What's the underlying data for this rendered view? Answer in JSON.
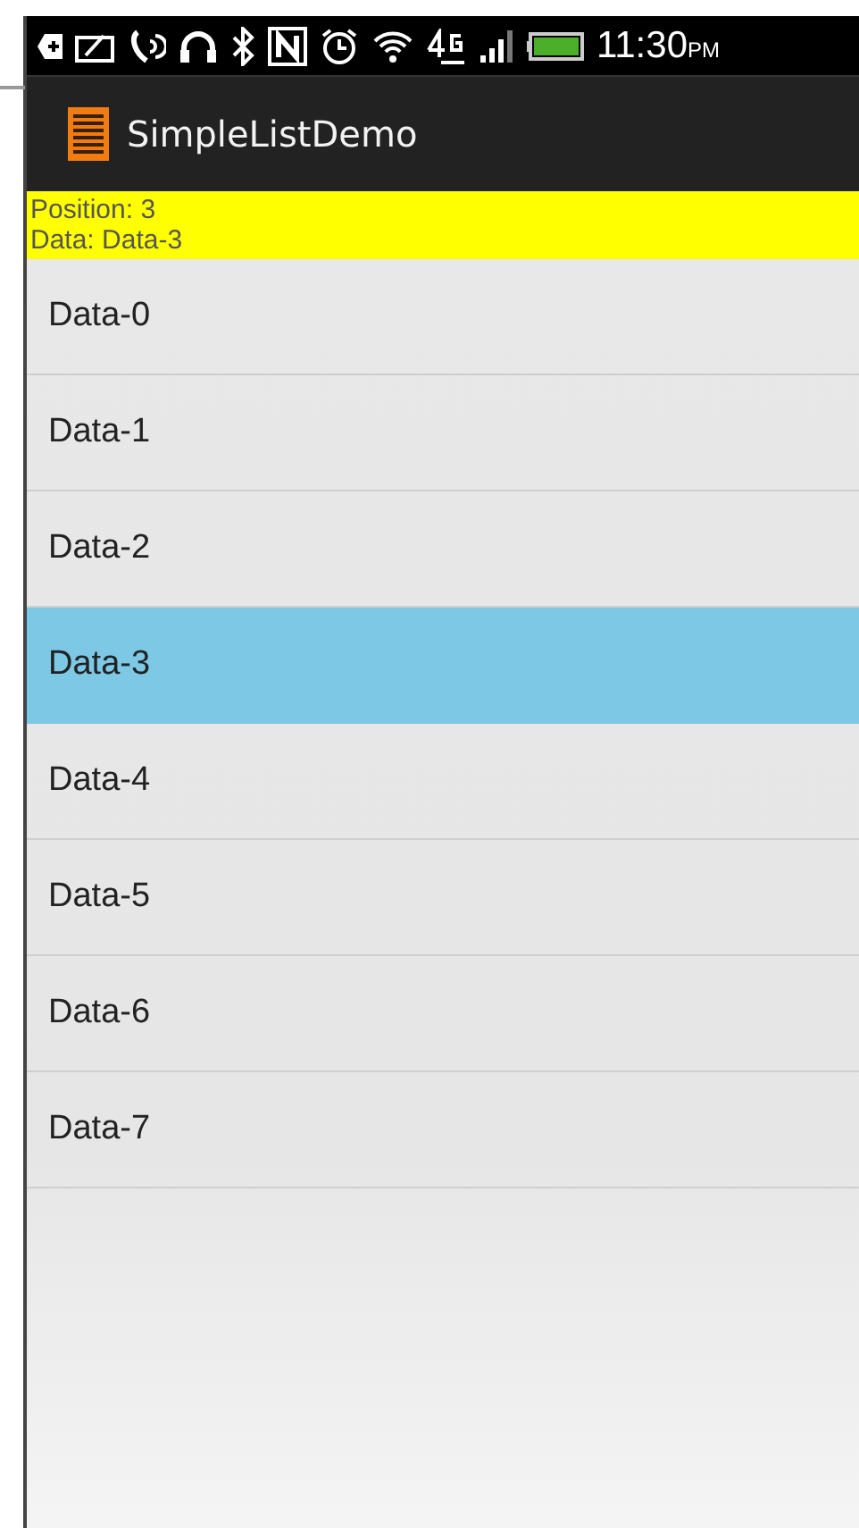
{
  "status_bar": {
    "time": "11:30",
    "period": "PM"
  },
  "app_bar": {
    "title": "SimpleListDemo"
  },
  "info": {
    "position": "Position: 3",
    "data": "Data: Data-3"
  },
  "list": [
    {
      "label": "Data-0",
      "selected": false
    },
    {
      "label": "Data-1",
      "selected": false
    },
    {
      "label": "Data-2",
      "selected": false
    },
    {
      "label": "Data-3",
      "selected": true
    },
    {
      "label": "Data-4",
      "selected": false
    },
    {
      "label": "Data-5",
      "selected": false
    },
    {
      "label": "Data-6",
      "selected": false
    },
    {
      "label": "Data-7",
      "selected": false
    }
  ]
}
